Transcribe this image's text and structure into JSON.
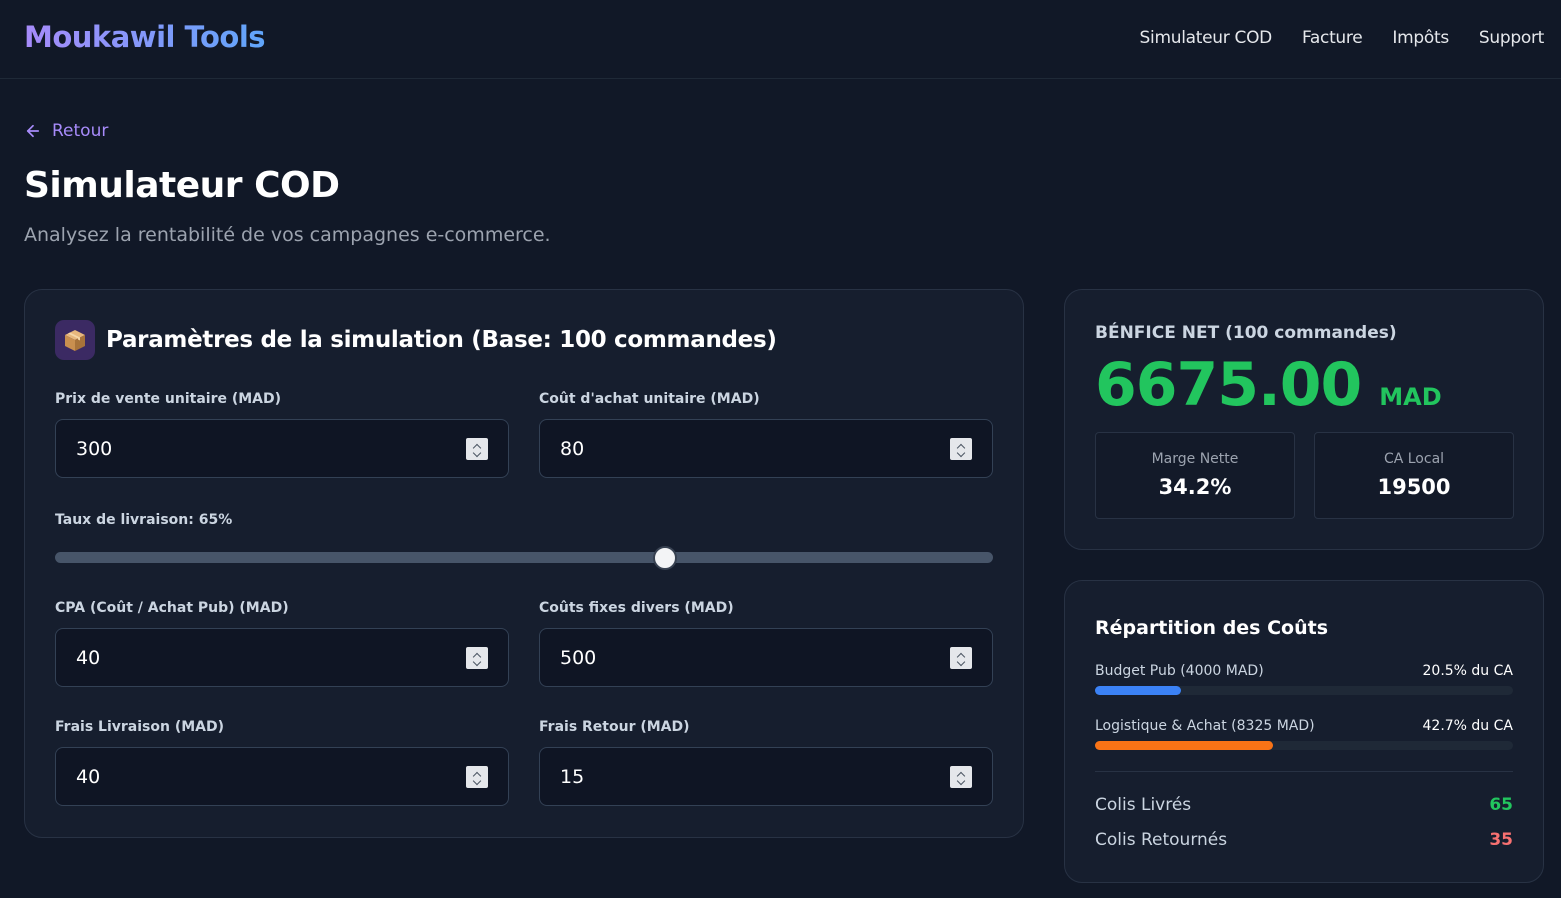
{
  "nav": {
    "logo": "Moukawil Tools",
    "links": [
      "Simulateur COD",
      "Facture",
      "Impôts",
      "Support"
    ]
  },
  "back_label": "Retour",
  "page": {
    "title": "Simulateur COD",
    "subtitle": "Analysez la rentabilité de vos campagnes e-commerce."
  },
  "params": {
    "icon": "package-icon",
    "title": "Paramètres de la simulation (Base: 100 commandes)",
    "fields": {
      "prix_vente": {
        "label": "Prix de vente unitaire (MAD)",
        "value": "300"
      },
      "cout_achat": {
        "label": "Coût d'achat unitaire (MAD)",
        "value": "80"
      },
      "cpa": {
        "label": "CPA (Coût / Achat Pub) (MAD)",
        "value": "40"
      },
      "couts_fixes": {
        "label": "Coûts fixes divers (MAD)",
        "value": "500"
      },
      "frais_livraison": {
        "label": "Frais Livraison (MAD)",
        "value": "40"
      },
      "frais_retour": {
        "label": "Frais Retour (MAD)",
        "value": "15"
      }
    },
    "slider": {
      "label": "Taux de livraison: 65%",
      "value": 65,
      "min": 0,
      "max": 100
    }
  },
  "result": {
    "label": "BÉNFICE NET (100 commandes)",
    "value": "6675.00",
    "unit": "MAD",
    "marge_label": "Marge Nette",
    "marge_value": "34.2%",
    "ca_label": "CA Local",
    "ca_value": "19500"
  },
  "costs": {
    "title": "Répartition des Coûts",
    "pub": {
      "label": "Budget Pub (4000 MAD)",
      "pct_label": "20.5% du CA",
      "pct": 20.5,
      "color": "#3b82f6"
    },
    "logistique": {
      "label": "Logistique & Achat (8325 MAD)",
      "pct_label": "42.7% du CA",
      "pct": 42.7,
      "color": "#f97316"
    },
    "livres_label": "Colis Livrés",
    "livres_value": "65",
    "livres_color": "#22c55e",
    "retournes_label": "Colis Retournés",
    "retournes_value": "35",
    "retournes_color": "#f87171"
  }
}
